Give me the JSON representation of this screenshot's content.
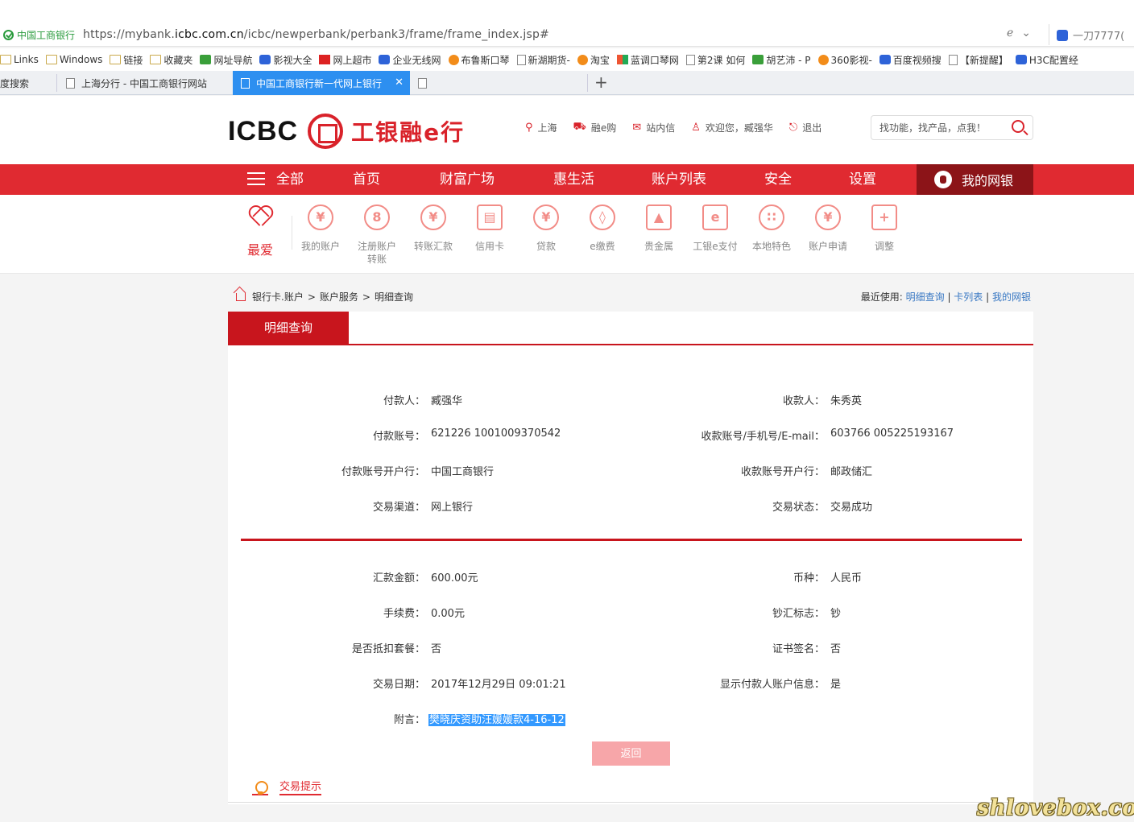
{
  "browser": {
    "site_name": "中国工商银行",
    "url_prefix": "https://mybank.",
    "url_domain": "icbc.com.cn",
    "url_path": "/icbc/newperbank/perbank3/frame/frame_index.jsp#",
    "search_text": "一刀7777(",
    "bookmarks": [
      "Links",
      "Windows",
      "链接",
      "收藏夹",
      "网址导航",
      "影视大全",
      "网上超市",
      "企业无线网",
      "布鲁斯口琴",
      "新湖期货-",
      "淘宝",
      "蓝调口琴网",
      "第2课 如何",
      "胡艺沛 - P",
      "360影视-",
      "百度视频搜",
      "【新提醒】",
      "H3C配置经"
    ],
    "tabs": [
      "度搜索",
      "上海分行 - 中国工商银行网站",
      "中国工商银行新一代网上银行",
      ""
    ],
    "new_tab": "+"
  },
  "header": {
    "logo_en": "ICBC",
    "logo_cn": "工银融e行",
    "links": [
      "上海",
      "融e购",
      "站内信",
      "欢迎您，臧强华",
      "退出"
    ],
    "search_placeholder": "找功能，找产品，点我！"
  },
  "nav": {
    "items": [
      "全部",
      "首页",
      "财富广场",
      "惠生活",
      "账户列表",
      "安全",
      "设置"
    ],
    "mybank": "我的网银"
  },
  "quick_icons": {
    "favorite": "最爱",
    "items": [
      {
        "label": "我的账户",
        "icon": "¥"
      },
      {
        "label": "注册账户转账",
        "icon": "8"
      },
      {
        "label": "转账汇款",
        "icon": "¥"
      },
      {
        "label": "信用卡",
        "icon": "▤"
      },
      {
        "label": "贷款",
        "icon": "¥"
      },
      {
        "label": "e缴费",
        "icon": "◊"
      },
      {
        "label": "贵金属",
        "icon": "▲"
      },
      {
        "label": "工银e支付",
        "icon": "e"
      },
      {
        "label": "本地特色",
        "icon": "∷"
      },
      {
        "label": "账户申请",
        "icon": "¥"
      },
      {
        "label": "调整",
        "icon": "+"
      }
    ]
  },
  "breadcrumb": {
    "items": [
      "银行卡.账户",
      "账户服务",
      "明细查询"
    ],
    "sep": ">",
    "recent_label": "最近使用:",
    "recent": [
      "明细查询",
      "卡列表",
      "我的网银"
    ]
  },
  "detail": {
    "tab_title": "明细查询",
    "left": [
      {
        "label": "付款人：",
        "value": "臧强华"
      },
      {
        "label": "付款账号：",
        "value": "621226 1001009370542"
      },
      {
        "label": "付款账号开户行：",
        "value": "中国工商银行"
      },
      {
        "label": "交易渠道：",
        "value": "网上银行"
      }
    ],
    "right": [
      {
        "label": "收款人：",
        "value": "朱秀英"
      },
      {
        "label": "收款账号/手机号/E-mail：",
        "value": "603766 005225193167"
      },
      {
        "label": "收款账号开户行：",
        "value": "邮政储汇"
      },
      {
        "label": "交易状态：",
        "value": "交易成功"
      }
    ],
    "left2": [
      {
        "label": "汇款金额：",
        "value": "600.00元"
      },
      {
        "label": "手续费：",
        "value": "0.00元"
      },
      {
        "label": "是否抵扣套餐：",
        "value": "否"
      },
      {
        "label": "交易日期：",
        "value": "2017年12月29日 09:01:21"
      },
      {
        "label": "附言：",
        "value": "樊晓庆资助汪媛媛款4-16-12"
      }
    ],
    "right2": [
      {
        "label": "币种：",
        "value": "人民币"
      },
      {
        "label": "钞汇标志：",
        "value": "钞"
      },
      {
        "label": "证书签名：",
        "value": "否"
      },
      {
        "label": "显示付款人账户信息：",
        "value": "是"
      }
    ],
    "return_button": "返回",
    "tips": "交易提示"
  },
  "watermark": "shlovebox.com"
}
